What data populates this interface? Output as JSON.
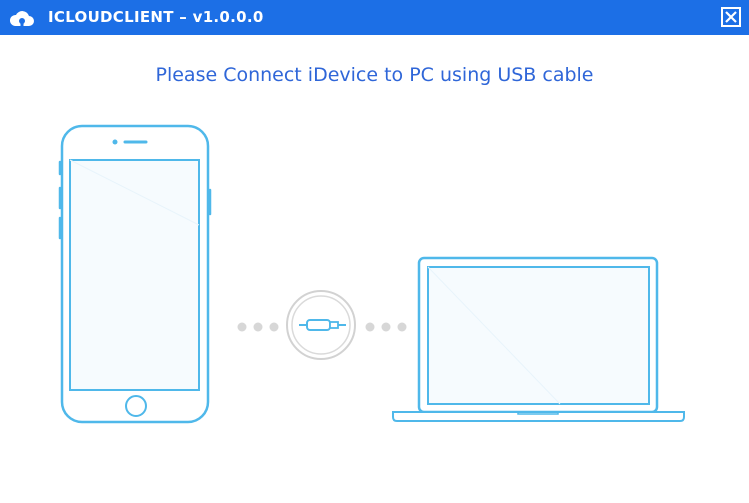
{
  "window": {
    "title": "ICLOUDCLIENT – v1.0.0.0",
    "logo_icon": "cloud-icon",
    "close_icon": "close-icon",
    "titlebar_color": "#1c6fe6"
  },
  "main": {
    "instruction": "Please Connect iDevice to PC using USB cable",
    "instruction_color": "#2f66d8",
    "illustration": {
      "device_icon": "iphone-icon",
      "connector_icon": "usb-cable-icon",
      "computer_icon": "laptop-icon",
      "outline_color": "#4fb8ea",
      "screen_color": "#f6fbfe",
      "dot_color": "#d7d7d7"
    }
  }
}
